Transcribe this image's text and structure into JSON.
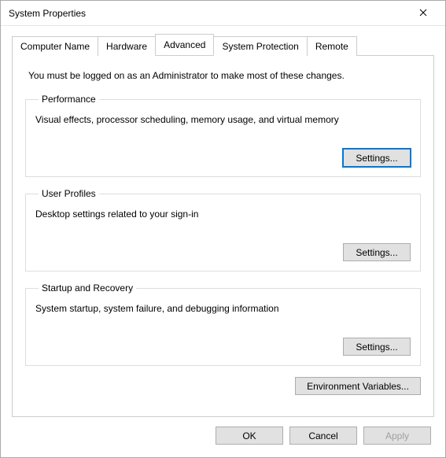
{
  "window": {
    "title": "System Properties",
    "close": "✕"
  },
  "tabs": {
    "computer_name": "Computer Name",
    "hardware": "Hardware",
    "advanced": "Advanced",
    "system_protection": "System Protection",
    "remote": "Remote"
  },
  "advanced": {
    "intro": "You must be logged on as an Administrator to make most of these changes.",
    "performance": {
      "legend": "Performance",
      "desc": "Visual effects, processor scheduling, memory usage, and virtual memory",
      "settings": "Settings..."
    },
    "user_profiles": {
      "legend": "User Profiles",
      "desc": "Desktop settings related to your sign-in",
      "settings": "Settings..."
    },
    "startup": {
      "legend": "Startup and Recovery",
      "desc": "System startup, system failure, and debugging information",
      "settings": "Settings..."
    },
    "env_vars": "Environment Variables..."
  },
  "buttons": {
    "ok": "OK",
    "cancel": "Cancel",
    "apply": "Apply"
  }
}
